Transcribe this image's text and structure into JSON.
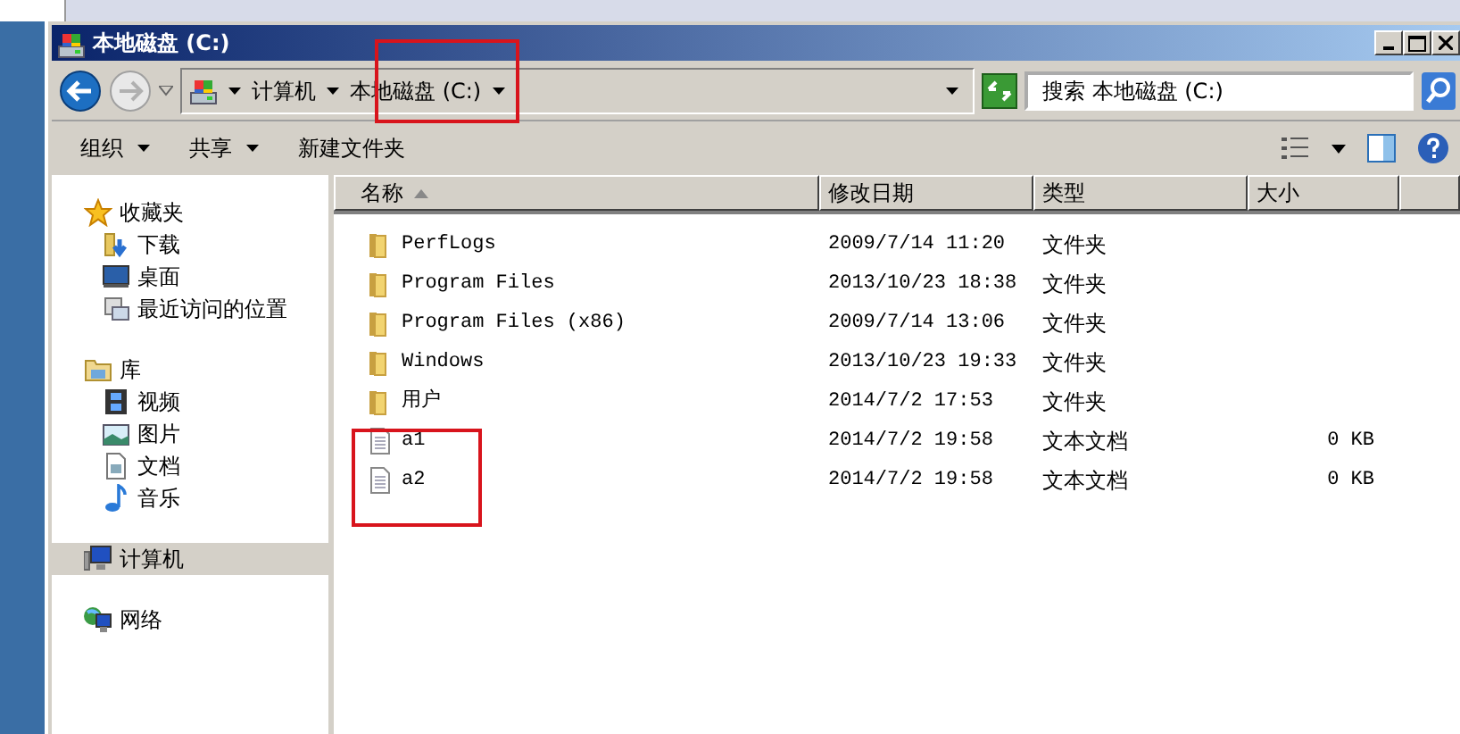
{
  "window": {
    "title": "本地磁盘 (C:)"
  },
  "address": {
    "crumbs": [
      "计算机",
      "本地磁盘 (C:)"
    ]
  },
  "search": {
    "placeholder": "搜索 本地磁盘 (C:)"
  },
  "toolbar": [
    {
      "label": "组织",
      "dropdown": true
    },
    {
      "label": "共享",
      "dropdown": true
    },
    {
      "label": "新建文件夹",
      "dropdown": false
    }
  ],
  "sidebar": {
    "groups": [
      {
        "label": "收藏夹",
        "selected": false,
        "children": [
          {
            "label": "下载",
            "selected": false
          },
          {
            "label": "桌面",
            "selected": false
          },
          {
            "label": "最近访问的位置",
            "selected": false
          }
        ]
      },
      {
        "label": "库",
        "selected": false,
        "children": [
          {
            "label": "视频",
            "selected": false
          },
          {
            "label": "图片",
            "selected": false
          },
          {
            "label": "文档",
            "selected": false
          },
          {
            "label": "音乐",
            "selected": false
          }
        ]
      },
      {
        "label": "计算机",
        "selected": true
      },
      {
        "label": "网络",
        "selected": false
      }
    ]
  },
  "table": {
    "columns": [
      {
        "label": "名称",
        "sorted": true
      },
      {
        "label": "修改日期",
        "sorted": false
      },
      {
        "label": "类型",
        "sorted": false
      },
      {
        "label": "大小",
        "sorted": false
      }
    ],
    "rows": [
      {
        "kind": "folder",
        "name": "PerfLogs",
        "modified": "2009/7/14 11:20",
        "type": "文件夹"
      },
      {
        "kind": "folder",
        "name": "Program Files",
        "modified": "2013/10/23 18:38",
        "type": "文件夹"
      },
      {
        "kind": "folder",
        "name": "Program Files (x86)",
        "modified": "2009/7/14 13:06",
        "type": "文件夹"
      },
      {
        "kind": "folder",
        "name": "Windows",
        "modified": "2013/10/23 19:33",
        "type": "文件夹"
      },
      {
        "kind": "folder",
        "name": "用户",
        "modified": "2014/7/2 17:53",
        "type": "文件夹"
      },
      {
        "kind": "text",
        "name": "a1",
        "modified": "2014/7/2 19:58",
        "type": "文本文档",
        "size": "0 KB"
      },
      {
        "kind": "text",
        "name": "a2",
        "modified": "2014/7/2 19:58",
        "type": "文本文档",
        "size": "0 KB"
      }
    ]
  }
}
